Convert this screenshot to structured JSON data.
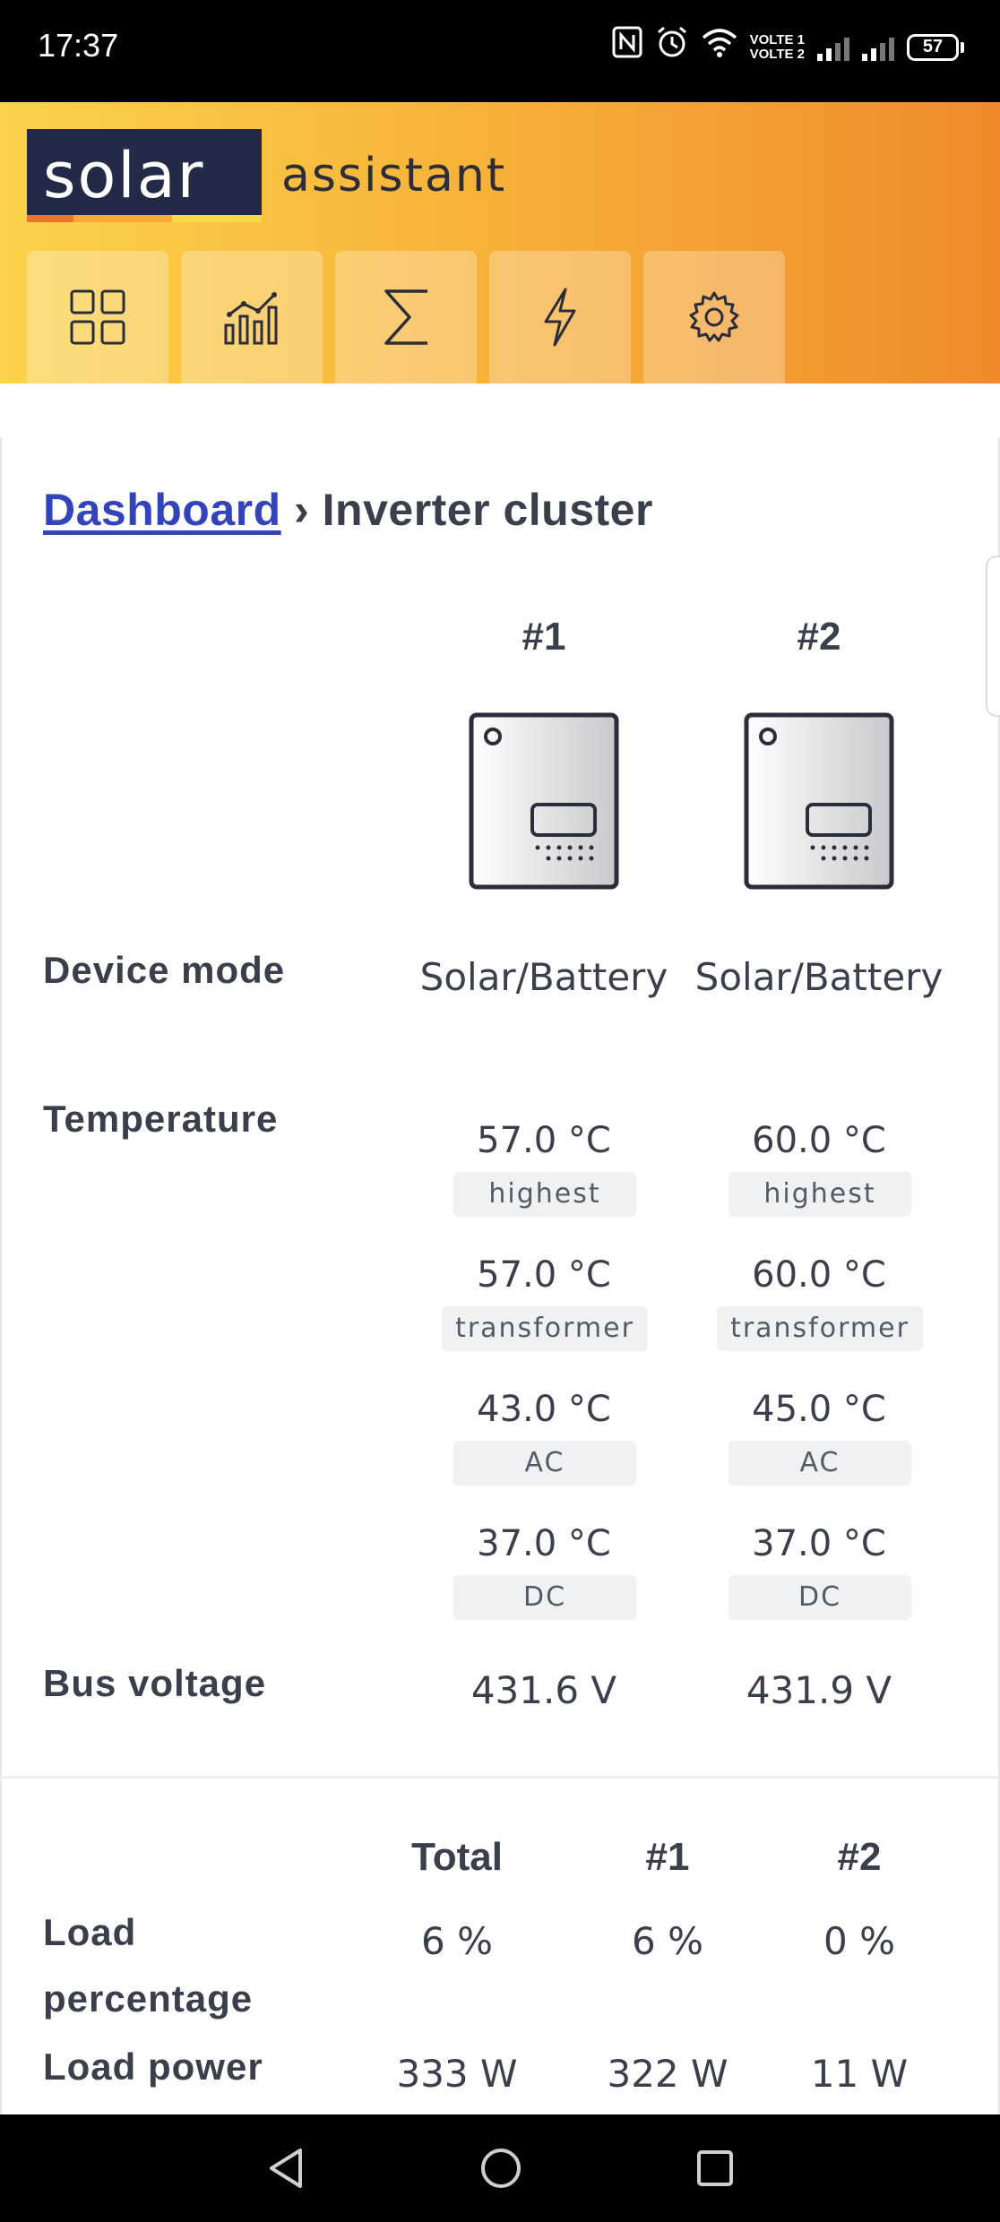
{
  "status_bar": {
    "time": "17:37",
    "volte1": "VOLTE 1",
    "volte2": "VOLTE 2",
    "battery": "57"
  },
  "header": {
    "logo_primary": "solar",
    "logo_secondary": "assistant",
    "nav_icons": [
      "dashboard-grid-icon",
      "chart-icon",
      "sigma-icon",
      "lightning-icon",
      "gear-icon"
    ],
    "colors": {
      "gradient_start": "#fbd24b",
      "gradient_end": "#f08a2c",
      "logo_bg": "#232a47"
    }
  },
  "breadcrumb": {
    "link": "Dashboard",
    "separator": "›",
    "current": "Inverter cluster"
  },
  "inverters": [
    {
      "label": "#1",
      "device_mode": "Solar/Battery",
      "temperatures": [
        {
          "value": "57.0 °C",
          "label": "highest"
        },
        {
          "value": "57.0 °C",
          "label": "transformer"
        },
        {
          "value": "43.0 °C",
          "label": "AC"
        },
        {
          "value": "37.0 °C",
          "label": "DC"
        }
      ],
      "bus_voltage": "431.6 V"
    },
    {
      "label": "#2",
      "device_mode": "Solar/Battery",
      "temperatures": [
        {
          "value": "60.0 °C",
          "label": "highest"
        },
        {
          "value": "60.0 °C",
          "label": "transformer"
        },
        {
          "value": "45.0 °C",
          "label": "AC"
        },
        {
          "value": "37.0 °C",
          "label": "DC"
        }
      ],
      "bus_voltage": "431.9 V"
    }
  ],
  "row_labels": {
    "device_mode": "Device mode",
    "temperature": "Temperature",
    "bus_voltage": "Bus voltage"
  },
  "load_table": {
    "headers": [
      "Total",
      "#1",
      "#2"
    ],
    "rows": [
      {
        "label": "Load percentage",
        "values": [
          "6 %",
          "6 %",
          "0 %"
        ]
      },
      {
        "label": "Load power",
        "values": [
          "333 W",
          "322 W",
          "11 W"
        ]
      }
    ]
  }
}
